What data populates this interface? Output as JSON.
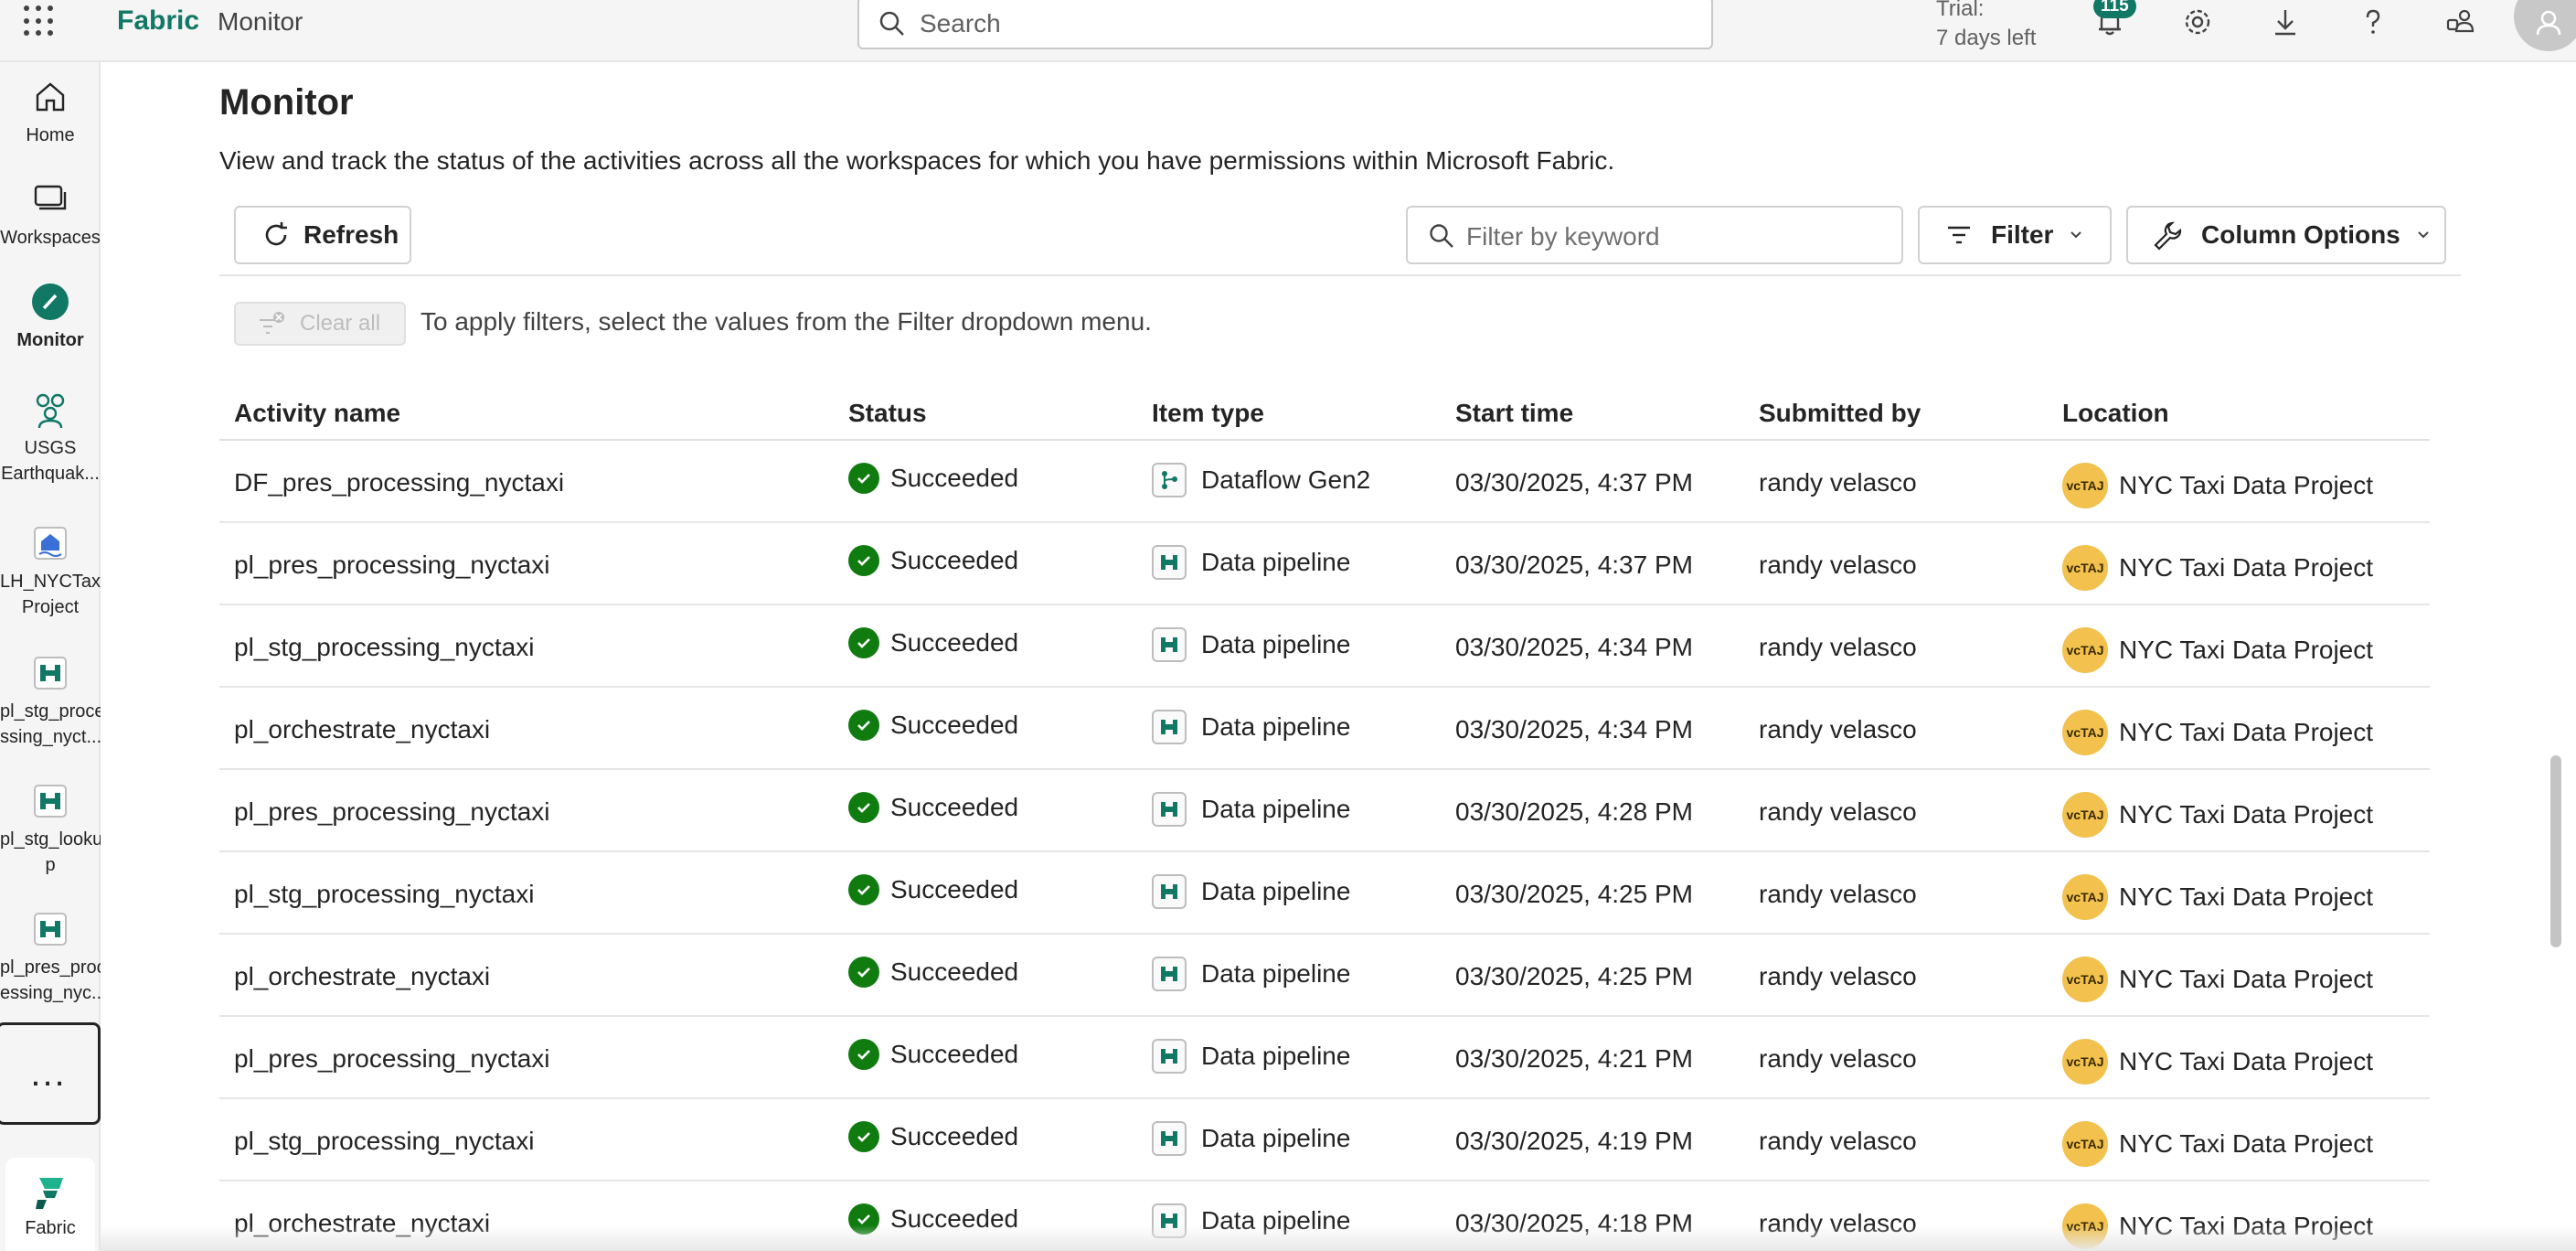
{
  "topbar": {
    "brand": "Fabric",
    "section": "Monitor",
    "search_placeholder": "Search",
    "trial_line1": "Trial:",
    "trial_line2": "7 days left",
    "notification_count": "115"
  },
  "rail": {
    "items": [
      {
        "label": "Home"
      },
      {
        "label": "Workspaces"
      },
      {
        "label": "Monitor"
      },
      {
        "label_1": "USGS",
        "label_2": "Earthquak..."
      },
      {
        "label_1": "LH_NYCTaxi",
        "label_2": "Project"
      },
      {
        "label_1": "pl_stg_proce",
        "label_2": "ssing_nyct..."
      },
      {
        "label_1": "pl_stg_looku",
        "label_2": "p"
      },
      {
        "label_1": "pl_pres_proc",
        "label_2": "essing_nyc..."
      }
    ],
    "more": "...",
    "fabric_label": "Fabric"
  },
  "page": {
    "title": "Monitor",
    "description": "View and track the status of the activities across all the workspaces for which you have permissions within Microsoft Fabric.",
    "refresh": "Refresh",
    "filter_placeholder": "Filter by keyword",
    "filter": "Filter",
    "column_options": "Column Options",
    "clear_all": "Clear all",
    "hint": "To apply filters, select the values from the Filter dropdown menu."
  },
  "table": {
    "headers": [
      "Activity name",
      "Status",
      "Item type",
      "Start time",
      "Submitted by",
      "Location"
    ],
    "rows": [
      {
        "name": "DF_pres_processing_nyctaxi",
        "status": "Succeeded",
        "type": "Dataflow Gen2",
        "start": "03/30/2025, 4:37 PM",
        "by": "randy velasco",
        "location": "NYC Taxi Data Project"
      },
      {
        "name": "pl_pres_processing_nyctaxi",
        "status": "Succeeded",
        "type": "Data pipeline",
        "start": "03/30/2025, 4:37 PM",
        "by": "randy velasco",
        "location": "NYC Taxi Data Project"
      },
      {
        "name": "pl_stg_processing_nyctaxi",
        "status": "Succeeded",
        "type": "Data pipeline",
        "start": "03/30/2025, 4:34 PM",
        "by": "randy velasco",
        "location": "NYC Taxi Data Project"
      },
      {
        "name": "pl_orchestrate_nyctaxi",
        "status": "Succeeded",
        "type": "Data pipeline",
        "start": "03/30/2025, 4:34 PM",
        "by": "randy velasco",
        "location": "NYC Taxi Data Project"
      },
      {
        "name": "pl_pres_processing_nyctaxi",
        "status": "Succeeded",
        "type": "Data pipeline",
        "start": "03/30/2025, 4:28 PM",
        "by": "randy velasco",
        "location": "NYC Taxi Data Project"
      },
      {
        "name": "pl_stg_processing_nyctaxi",
        "status": "Succeeded",
        "type": "Data pipeline",
        "start": "03/30/2025, 4:25 PM",
        "by": "randy velasco",
        "location": "NYC Taxi Data Project"
      },
      {
        "name": "pl_orchestrate_nyctaxi",
        "status": "Succeeded",
        "type": "Data pipeline",
        "start": "03/30/2025, 4:25 PM",
        "by": "randy velasco",
        "location": "NYC Taxi Data Project"
      },
      {
        "name": "pl_pres_processing_nyctaxi",
        "status": "Succeeded",
        "type": "Data pipeline",
        "start": "03/30/2025, 4:21 PM",
        "by": "randy velasco",
        "location": "NYC Taxi Data Project"
      },
      {
        "name": "pl_stg_processing_nyctaxi",
        "status": "Succeeded",
        "type": "Data pipeline",
        "start": "03/30/2025, 4:19 PM",
        "by": "randy velasco",
        "location": "NYC Taxi Data Project"
      },
      {
        "name": "pl_orchestrate_nyctaxi",
        "status": "Succeeded",
        "type": "Data pipeline",
        "start": "03/30/2025, 4:18 PM",
        "by": "randy velasco",
        "location": "NYC Taxi Data Project"
      }
    ]
  },
  "colors": {
    "accent": "#117865",
    "success": "#107c10",
    "location_badge": "#f2c14e"
  }
}
